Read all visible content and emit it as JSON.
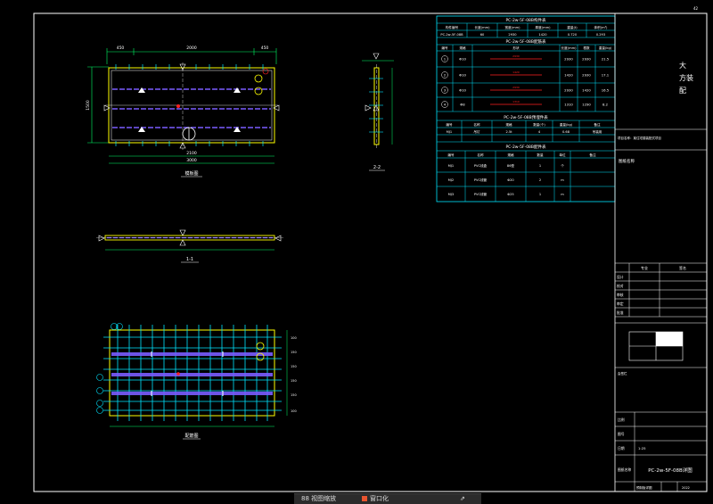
{
  "drawing": {
    "sheet_title": "PC-2w-5F-08B详图",
    "page_label": "42",
    "plan_view_label": "模板图",
    "section_a_label": "1-1",
    "section_b_label": "2-2",
    "rebar_view_label": "配筋图",
    "top_dims": [
      "450",
      "2000",
      "450"
    ],
    "overall_width": "3000",
    "inner_width": "2100",
    "left_dim": "1500",
    "callout_circles": [
      "①",
      "②",
      "③",
      "④"
    ]
  },
  "tables": {
    "component_table_title": "PC-2w-5F-08B构件表",
    "component_headers": [
      "构件编号",
      "长度(mm)",
      "宽度(mm)",
      "厚度(mm)",
      "重量(t)",
      "体积(m³)"
    ],
    "component_row": [
      "PC-2w-5F-08B",
      "60",
      "2930",
      "1420",
      "0.720",
      "0.293"
    ],
    "rebar_table_title": "PC-2w-5F-08B配筋表",
    "rebar_headers": [
      "编号",
      "规格",
      "形状",
      "长度(mm)",
      "根数",
      "重量(kg)"
    ],
    "rebar_rows": [
      {
        "no": "1",
        "spec": "Φ10",
        "len": "2930",
        "count": "2930",
        "weight": "21.5"
      },
      {
        "no": "2",
        "spec": "Φ10",
        "len": "1420",
        "count": "2930",
        "weight": "17.1"
      },
      {
        "no": "3",
        "spec": "Φ10",
        "len": "2930",
        "count": "1420",
        "weight": "16.5"
      },
      {
        "no": "4",
        "spec": "Φ8",
        "len": "1310",
        "count": "1290",
        "weight": "8.2"
      }
    ],
    "embed_table_title": "PC-2w-5F-08B预埋件表",
    "embed_headers": [
      "编号",
      "名称",
      "规格",
      "数量(个)",
      "重量(kg)",
      "备注"
    ],
    "embed_row": [
      "MJ1",
      "吊钉",
      "2.5t",
      "4",
      "0.68",
      "吊装用"
    ],
    "parts_table_title": "PC-2w-5F-08B配件表",
    "parts_headers": [
      "编号",
      "名称",
      "规格",
      "数量",
      "单位",
      "备注"
    ],
    "parts_rows": [
      [
        "MJ1",
        "PVC线盒",
        "86型",
        "1",
        "个"
      ],
      [
        "MJ2",
        "PVC线管",
        "Φ20",
        "2",
        "m"
      ],
      [
        "MJ3",
        "PVC线管",
        "Φ25",
        "1",
        "m"
      ]
    ]
  },
  "title_block": {
    "company_line1": "大",
    "company_line2": "方装",
    "company_line3": "配",
    "project_note": "项目名称：某住宅楼装配式项目",
    "building_label": "图纸名称",
    "sign_header_a": "专业",
    "sign_header_b": "签名",
    "sign_rows": [
      "设计",
      "校对",
      "审核",
      "审定",
      "批准"
    ],
    "stamp_label": "会签栏",
    "scale_label": "比例",
    "scale_value": "1:25",
    "drawing_no_label": "图号",
    "date_label": "日期",
    "date_value": "2022",
    "sheet_label": "图纸名称",
    "sheet_name": "PC-2w-5F-08B详图",
    "footer_label": "预制板详图",
    "footer_value": "PC"
  },
  "taskbar": {
    "item1": "88 视图缩放",
    "item2": "窗口化",
    "item3": "⇗"
  },
  "colors": {
    "frame": "#ffffff",
    "cyan": "#00e5ff",
    "yellow": "#ffff00",
    "green": "#00ff66",
    "purple": "#7b5cff",
    "red": "#ff2020",
    "bg": "#000000"
  }
}
